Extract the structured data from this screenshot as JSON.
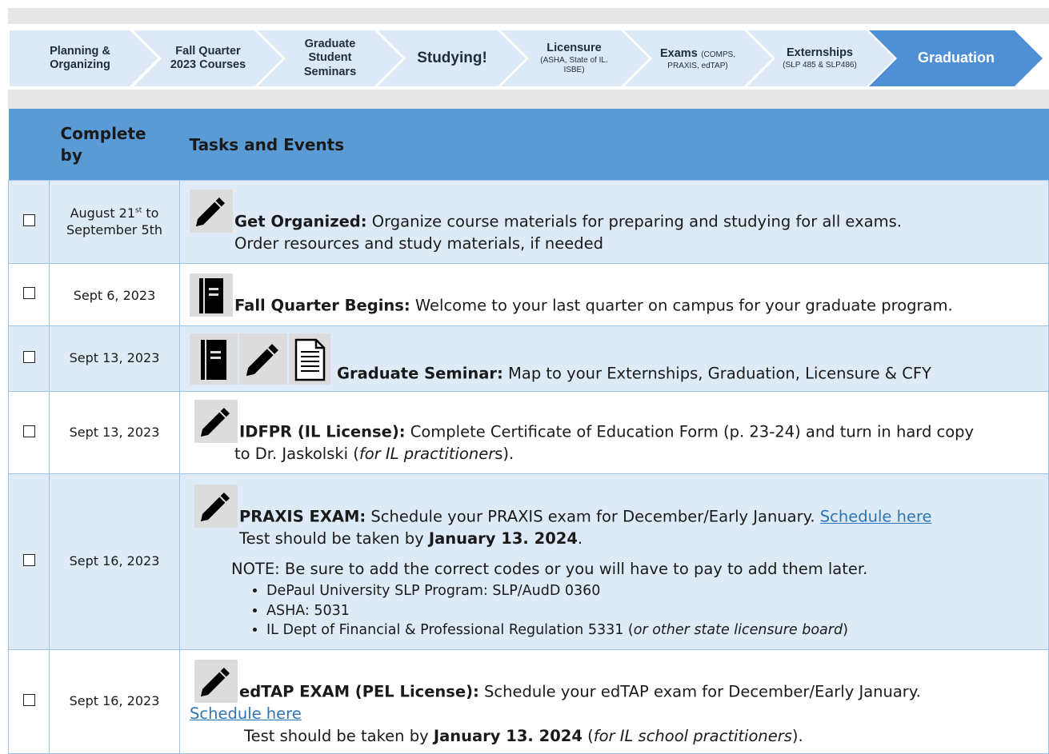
{
  "steps": [
    {
      "title": "Planning & Organizing",
      "line1": "Planning &",
      "line2": "Organizing"
    },
    {
      "line1": "Fall Quarter",
      "line2": "2023 Courses"
    },
    {
      "line1": "Graduate",
      "line2": "Student",
      "line3": "Seminars"
    },
    {
      "title": "Studying!"
    },
    {
      "title": "Licensure",
      "sub1": "(ASHA, State of IL.",
      "sub2": "ISBE)"
    },
    {
      "title": "Exams",
      "sub_inline": "(COMPS,",
      "sub2": "PRAXIS, edTAP)"
    },
    {
      "title": "Externships",
      "sub1": "(SLP 485 & SLP486)"
    },
    {
      "title": "Graduation"
    }
  ],
  "table": {
    "header": {
      "complete_by_1": "Complete",
      "complete_by_2": "by",
      "tasks": "Tasks and Events"
    },
    "rows": [
      {
        "date_1": "August 21",
        "date_sup": "st",
        "date_2": " to",
        "date_3": "September 5th",
        "icons": [
          "pencil-icon"
        ],
        "title": "Get Organized:",
        "text": " Organize course materials for preparing and studying for all exams.",
        "text2": "Order resources and study materials, if needed"
      },
      {
        "date": "Sept 6, 2023",
        "icons": [
          "book-icon"
        ],
        "title": "Fall Quarter Begins:",
        "text": " Welcome to your last quarter on campus for your graduate program."
      },
      {
        "date": "Sept 13, 2023",
        "icons": [
          "book-icon",
          "pencil-icon",
          "document-icon"
        ],
        "title": "Graduate Seminar:",
        "text": " Map to your Externships, Graduation, Licensure & CFY"
      },
      {
        "date": "Sept 13, 2023",
        "icons": [
          "pencil-icon"
        ],
        "title": "IDFPR (IL License):",
        "text": " Complete Certificate of Education Form (p. 23-24) and turn in hard copy",
        "text2a": "to Dr. Jaskolski (",
        "text2b": "for IL practitioner",
        "text2c": "s)."
      },
      {
        "date": "Sept 16, 2023",
        "icons": [
          "pencil-icon"
        ],
        "title": "PRAXIS EXAM:",
        "text": " Schedule your PRAXIS exam for December/Early January. ",
        "link": "Schedule here",
        "line2a": " Test should be taken by ",
        "line2b": "January 13. 2024",
        "line2c": ".",
        "note": "NOTE: Be sure to add the correct codes or you will have to pay to add them later.",
        "codes": [
          "DePaul University SLP Program: SLP/AudD 0360",
          "ASHA: 5031"
        ],
        "code3a": "IL Dept of Financial & Professional Regulation 5331 (",
        "code3b": "or other state licensure board",
        "code3c": ")"
      },
      {
        "date": "Sept 16, 2023",
        "icons": [
          "pencil-icon"
        ],
        "title": "edTAP EXAM (PEL License):",
        "text": " Schedule your edTAP exam for December/Early January.",
        "link": "Schedule here",
        "line2a": "Test should be taken by ",
        "line2b": "January 13. 2024",
        "line2c": " (",
        "line2d": "for IL school practitioners",
        "line2e": ")."
      }
    ]
  },
  "colors": {
    "header": "#5b9bd5",
    "active_step": "#4f8fd4",
    "step": "#dde9f6",
    "row_shade": "#deebf7",
    "link": "#2e75b6"
  }
}
